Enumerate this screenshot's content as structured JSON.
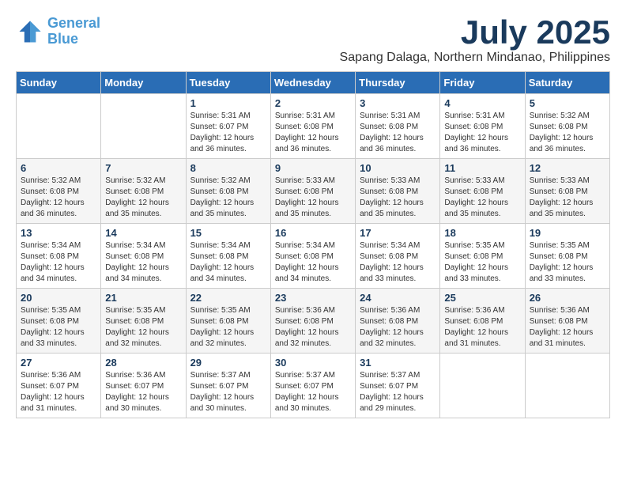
{
  "header": {
    "logo_line1": "General",
    "logo_line2": "Blue",
    "month_title": "July 2025",
    "location": "Sapang Dalaga, Northern Mindanao, Philippines"
  },
  "weekdays": [
    "Sunday",
    "Monday",
    "Tuesday",
    "Wednesday",
    "Thursday",
    "Friday",
    "Saturday"
  ],
  "weeks": [
    [
      {
        "day": "",
        "info": ""
      },
      {
        "day": "",
        "info": ""
      },
      {
        "day": "1",
        "info": "Sunrise: 5:31 AM\nSunset: 6:07 PM\nDaylight: 12 hours and 36 minutes."
      },
      {
        "day": "2",
        "info": "Sunrise: 5:31 AM\nSunset: 6:08 PM\nDaylight: 12 hours and 36 minutes."
      },
      {
        "day": "3",
        "info": "Sunrise: 5:31 AM\nSunset: 6:08 PM\nDaylight: 12 hours and 36 minutes."
      },
      {
        "day": "4",
        "info": "Sunrise: 5:31 AM\nSunset: 6:08 PM\nDaylight: 12 hours and 36 minutes."
      },
      {
        "day": "5",
        "info": "Sunrise: 5:32 AM\nSunset: 6:08 PM\nDaylight: 12 hours and 36 minutes."
      }
    ],
    [
      {
        "day": "6",
        "info": "Sunrise: 5:32 AM\nSunset: 6:08 PM\nDaylight: 12 hours and 36 minutes."
      },
      {
        "day": "7",
        "info": "Sunrise: 5:32 AM\nSunset: 6:08 PM\nDaylight: 12 hours and 35 minutes."
      },
      {
        "day": "8",
        "info": "Sunrise: 5:32 AM\nSunset: 6:08 PM\nDaylight: 12 hours and 35 minutes."
      },
      {
        "day": "9",
        "info": "Sunrise: 5:33 AM\nSunset: 6:08 PM\nDaylight: 12 hours and 35 minutes."
      },
      {
        "day": "10",
        "info": "Sunrise: 5:33 AM\nSunset: 6:08 PM\nDaylight: 12 hours and 35 minutes."
      },
      {
        "day": "11",
        "info": "Sunrise: 5:33 AM\nSunset: 6:08 PM\nDaylight: 12 hours and 35 minutes."
      },
      {
        "day": "12",
        "info": "Sunrise: 5:33 AM\nSunset: 6:08 PM\nDaylight: 12 hours and 35 minutes."
      }
    ],
    [
      {
        "day": "13",
        "info": "Sunrise: 5:34 AM\nSunset: 6:08 PM\nDaylight: 12 hours and 34 minutes."
      },
      {
        "day": "14",
        "info": "Sunrise: 5:34 AM\nSunset: 6:08 PM\nDaylight: 12 hours and 34 minutes."
      },
      {
        "day": "15",
        "info": "Sunrise: 5:34 AM\nSunset: 6:08 PM\nDaylight: 12 hours and 34 minutes."
      },
      {
        "day": "16",
        "info": "Sunrise: 5:34 AM\nSunset: 6:08 PM\nDaylight: 12 hours and 34 minutes."
      },
      {
        "day": "17",
        "info": "Sunrise: 5:34 AM\nSunset: 6:08 PM\nDaylight: 12 hours and 33 minutes."
      },
      {
        "day": "18",
        "info": "Sunrise: 5:35 AM\nSunset: 6:08 PM\nDaylight: 12 hours and 33 minutes."
      },
      {
        "day": "19",
        "info": "Sunrise: 5:35 AM\nSunset: 6:08 PM\nDaylight: 12 hours and 33 minutes."
      }
    ],
    [
      {
        "day": "20",
        "info": "Sunrise: 5:35 AM\nSunset: 6:08 PM\nDaylight: 12 hours and 33 minutes."
      },
      {
        "day": "21",
        "info": "Sunrise: 5:35 AM\nSunset: 6:08 PM\nDaylight: 12 hours and 32 minutes."
      },
      {
        "day": "22",
        "info": "Sunrise: 5:35 AM\nSunset: 6:08 PM\nDaylight: 12 hours and 32 minutes."
      },
      {
        "day": "23",
        "info": "Sunrise: 5:36 AM\nSunset: 6:08 PM\nDaylight: 12 hours and 32 minutes."
      },
      {
        "day": "24",
        "info": "Sunrise: 5:36 AM\nSunset: 6:08 PM\nDaylight: 12 hours and 32 minutes."
      },
      {
        "day": "25",
        "info": "Sunrise: 5:36 AM\nSunset: 6:08 PM\nDaylight: 12 hours and 31 minutes."
      },
      {
        "day": "26",
        "info": "Sunrise: 5:36 AM\nSunset: 6:08 PM\nDaylight: 12 hours and 31 minutes."
      }
    ],
    [
      {
        "day": "27",
        "info": "Sunrise: 5:36 AM\nSunset: 6:07 PM\nDaylight: 12 hours and 31 minutes."
      },
      {
        "day": "28",
        "info": "Sunrise: 5:36 AM\nSunset: 6:07 PM\nDaylight: 12 hours and 30 minutes."
      },
      {
        "day": "29",
        "info": "Sunrise: 5:37 AM\nSunset: 6:07 PM\nDaylight: 12 hours and 30 minutes."
      },
      {
        "day": "30",
        "info": "Sunrise: 5:37 AM\nSunset: 6:07 PM\nDaylight: 12 hours and 30 minutes."
      },
      {
        "day": "31",
        "info": "Sunrise: 5:37 AM\nSunset: 6:07 PM\nDaylight: 12 hours and 29 minutes."
      },
      {
        "day": "",
        "info": ""
      },
      {
        "day": "",
        "info": ""
      }
    ]
  ]
}
